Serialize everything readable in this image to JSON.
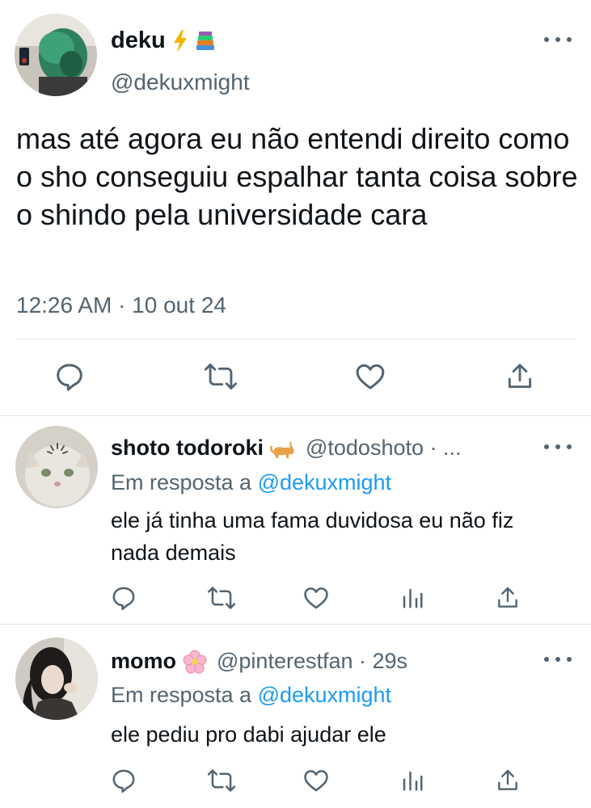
{
  "main_tweet": {
    "author_name": "deku",
    "author_emojis": [
      "lightning-bolt-emoji",
      "books-emoji"
    ],
    "handle": "@dekuxmight",
    "text": "mas até agora eu não entendi direito como o sho conseguiu espalhar tanta coisa sobre o shindo pela universidade cara",
    "timestamp": "12:26 AM · 10 out 24",
    "actions": [
      "reply-icon",
      "retweet-icon",
      "like-icon",
      "share-icon"
    ]
  },
  "replies": [
    {
      "author_name": "shoto todoroki",
      "author_emoji": "cat-emoji",
      "handle": "@todoshoto · ...",
      "reply_prefix": "Em resposta a ",
      "reply_to": "@dekuxmight",
      "text": "ele já tinha uma fama duvidosa eu não fiz nada demais"
    },
    {
      "author_name": "momo",
      "author_emoji": "cherry-blossom-emoji",
      "handle": "@pinterestfan · 29s",
      "reply_prefix": "Em resposta a ",
      "reply_to": "@dekuxmight",
      "text": "ele pediu pro dabi ajudar ele"
    }
  ],
  "colors": {
    "text": "#0f1419",
    "secondary": "#536471",
    "link": "#1d9bf0",
    "divider": "#e1e6ea"
  }
}
